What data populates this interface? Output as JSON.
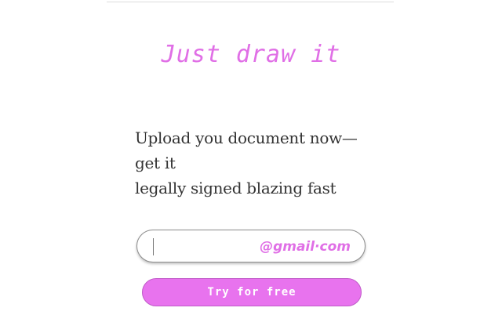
{
  "headline": "Just draw it",
  "tagline": {
    "line1": "Upload you document now—get it",
    "line2": "legally signed blazing fast"
  },
  "email_field": {
    "value": "",
    "placeholder": "",
    "domain_suffix": "@gmail·com"
  },
  "cta": {
    "label": "Try for free"
  },
  "colors": {
    "accent": "#e06fe6",
    "button_bg": "#e873ee",
    "text": "#333333"
  }
}
